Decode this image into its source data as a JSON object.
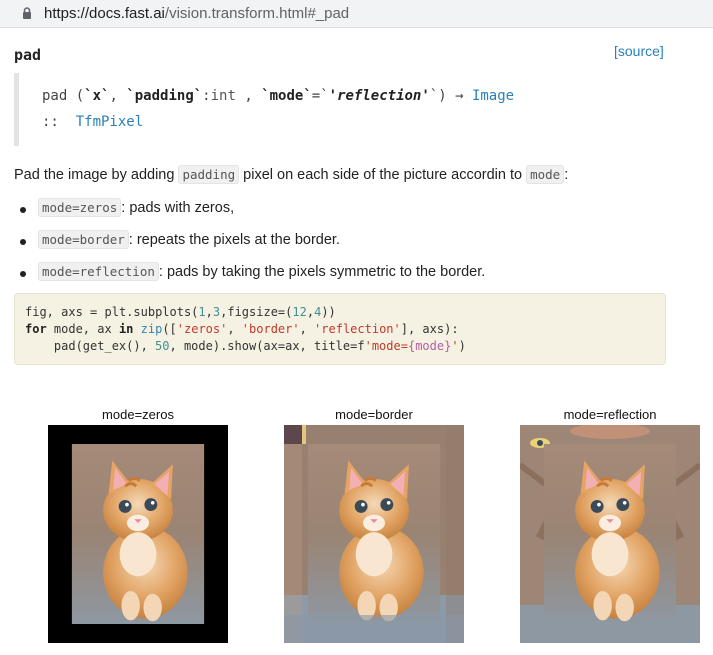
{
  "browser": {
    "url_host": "https://docs.fast.ai",
    "url_path": "/vision.transform.html#_pad"
  },
  "doc": {
    "function_name": "pad",
    "source_link": "[source]",
    "signature": {
      "name": "pad",
      "open": " (",
      "arg1": "`x`",
      "sep1": ", ",
      "arg2": "`padding`",
      "colon": ":",
      "arg2_type": "int",
      "sep2": " , ",
      "arg3": "`mode`",
      "eq": "=`",
      "arg3_default": "'reflection'",
      "close": "`)",
      "arrow": " → ",
      "return_type": "Image",
      "line2_prefix": "::",
      "line2_type": "TfmPixel"
    },
    "description": {
      "pre": "Pad the image by adding ",
      "code1": "padding",
      "mid": " pixel on each side of the picture accordin to ",
      "code2": "mode",
      "post": ":"
    },
    "bullets": [
      {
        "code": "mode=zeros",
        "text": ": pads with zeros,"
      },
      {
        "code": "mode=border",
        "text": ": repeats the pixels at the border."
      },
      {
        "code": "mode=reflection",
        "text": ": pads by taking the pixels symmetric to the border."
      }
    ],
    "code_lines": {
      "l1_a": "fig, axs ",
      "l1_eq": "=",
      "l1_b": " plt.subplots(",
      "l1_n1": "1",
      "l1_c": ",",
      "l1_n2": "3",
      "l1_d": ",figsize",
      "l1_eq2": "=",
      "l1_e": "(",
      "l1_n3": "12",
      "l1_f": ",",
      "l1_n4": "4",
      "l1_g": "))",
      "l2_for": "for",
      "l2_a": " mode, ax ",
      "l2_in": "in",
      "l2_b": " ",
      "l2_zip": "zip",
      "l2_c": "([",
      "l2_s1": "'zeros'",
      "l2_d": ", ",
      "l2_s2": "'border'",
      "l2_e": ", ",
      "l2_s3": "'reflection'",
      "l2_f": "], axs):",
      "l3_a": "    pad(get_ex(), ",
      "l3_n": "50",
      "l3_b": ", mode).show(ax",
      "l3_eq": "=",
      "l3_c": "ax, title",
      "l3_eq2": "=",
      "l3_f": "f",
      "l3_s": "'mode=",
      "l3_brace": "{mode}",
      "l3_s_end": "'",
      "l3_end": ")"
    },
    "figure": {
      "titles": [
        "mode=zeros",
        "mode=border",
        "mode=reflection"
      ]
    }
  }
}
